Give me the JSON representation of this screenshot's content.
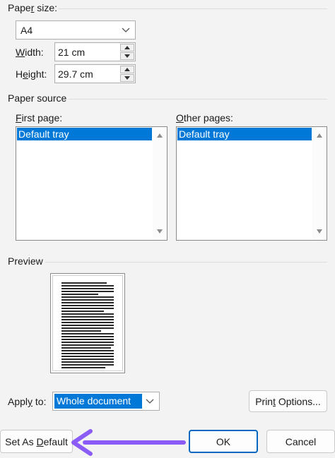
{
  "paper_size": {
    "label": "Paper size:",
    "label_access_key": "r",
    "selected": "A4",
    "width_label": "Width:",
    "width_access_key": "W",
    "width_value": "21 cm",
    "height_label": "Height:",
    "height_access_key": "e",
    "height_value": "29.7 cm"
  },
  "paper_source": {
    "label": "Paper source",
    "first_page_label": "First page:",
    "first_page_access_key": "F",
    "first_page_items": [
      "Default tray"
    ],
    "other_pages_label": "Other pages:",
    "other_pages_access_key": "O",
    "other_pages_items": [
      "Default tray"
    ]
  },
  "preview": {
    "label": "Preview"
  },
  "apply_to": {
    "label": "Apply to:",
    "label_access_key": "y",
    "selected": "Whole document"
  },
  "buttons": {
    "print_options": "Print Options...",
    "print_options_access_key": "t",
    "set_as_default": "Set As Default",
    "set_as_default_access_key": "D",
    "ok": "OK",
    "cancel": "Cancel"
  },
  "annotation": {
    "arrow_color": "#8b5cf6"
  },
  "colors": {
    "selection": "#0078d7",
    "primary_border": "#0067c0"
  }
}
